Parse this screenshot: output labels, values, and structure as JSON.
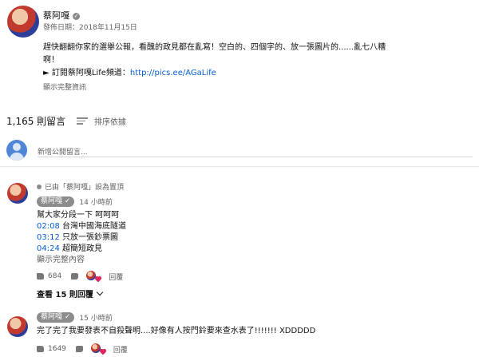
{
  "video": {
    "channel_name": "蔡阿嘎",
    "publish_date": "發佈日期：2018年11月15日",
    "description_line1": "趕快翻翻你家的選舉公報，看醜的政見都在亂寫！空白的、四個字的、放一張圖片的......亂七八糟",
    "description_line2": "啊！",
    "subscribe_prefix": "► 訂閱蔡阿嘎Life頻道：",
    "subscribe_link": "http://pics.ee/AGaLife",
    "show_more": "顯示完整資訊"
  },
  "comments_header": {
    "count": "1,165 則留言",
    "sort_label": "排序依據"
  },
  "new_comment": {
    "placeholder": "新增公開留言..."
  },
  "comments": [
    {
      "pinned_label": "已由「蔡阿嘎」設為置頂",
      "author": "蔡阿嘎",
      "time": "14 小時前",
      "line1": "幫大家分段一下 呵呵呵",
      "timestamps": [
        {
          "time": "02:08",
          "text": "台灣中國海底隧道"
        },
        {
          "time": "03:12",
          "text": "只放一張鈔票圖"
        },
        {
          "time": "04:24",
          "text": "超簡短政見"
        }
      ],
      "read_more": "顯示完整內容",
      "likes": "684",
      "reply": "回覆",
      "view_replies": "查看 15 則回覆"
    },
    {
      "author": "蔡阿嘎",
      "time": "15 小時前",
      "text": "完了完了我要發表不自殺聲明....好像有人按門鈴要來查水表了!!!!!!! XDDDDD",
      "likes": "1649",
      "reply": "回覆"
    }
  ],
  "colors": {
    "link": "#065fd4",
    "muted": "#606060",
    "heart": "#e0245e"
  }
}
